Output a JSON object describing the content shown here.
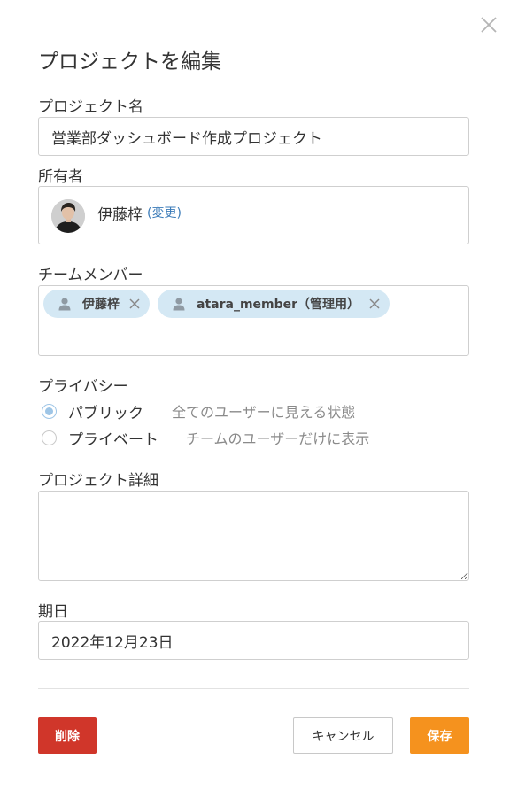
{
  "dialog": {
    "title": "プロジェクトを編集",
    "close_icon": "close-icon"
  },
  "project_name": {
    "label": "プロジェクト名",
    "value": "営業部ダッシュボード作成プロジェクト"
  },
  "owner": {
    "label": "所有者",
    "name": "伊藤梓",
    "change_link": "(変更)"
  },
  "team_members": {
    "label": "チームメンバー",
    "members": [
      {
        "name": "伊藤梓",
        "icon": "user-icon",
        "remove_icon": "remove-icon"
      },
      {
        "name": "atara_member（管理用）",
        "icon": "user-icon",
        "remove_icon": "remove-icon"
      }
    ]
  },
  "privacy": {
    "label": "プライバシー",
    "options": [
      {
        "label": "パブリック",
        "description": "全てのユーザーに見える状態",
        "selected": true
      },
      {
        "label": "プライベート",
        "description": "チームのユーザーだけに表示",
        "selected": false
      }
    ]
  },
  "detail": {
    "label": "プロジェクト詳細",
    "value": ""
  },
  "due_date": {
    "label": "期日",
    "value": "2022年12月23日"
  },
  "buttons": {
    "delete": "削除",
    "cancel": "キャンセル",
    "save": "保存"
  },
  "colors": {
    "delete": "#d0362a",
    "save": "#f5921e",
    "chip": "#d4e8f4",
    "link": "#3b7bb8",
    "radio_selected": "#9ec5e6"
  }
}
